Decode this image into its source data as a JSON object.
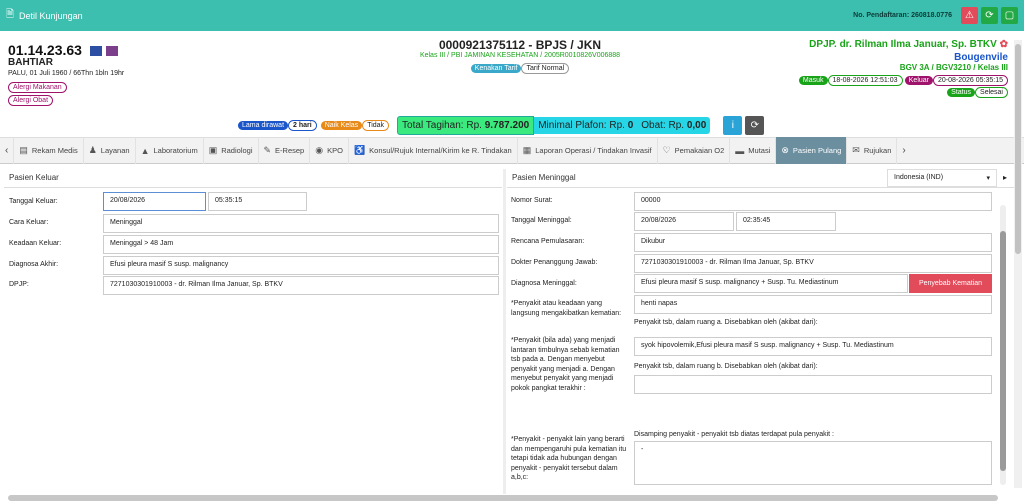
{
  "titlebar": {
    "title": "Detil Kunjungan",
    "reg_label": "No. Pendaftaran:",
    "reg_no": "260818.0776"
  },
  "patient": {
    "id": "01.14.23.63",
    "name": "BAHTIAR",
    "info": "PALU, 01 Juli 1960 / 66Thn 1bln 19hr",
    "allergy_food": "Alergi Makanan",
    "allergy_drug": "Alergi Obat"
  },
  "center": {
    "sep": "0000921375112 - BPJS / JKN",
    "kelas": "Kelas III / PBI JAMINAN KESEHATAN / 2005R0010826V006888",
    "kenakan": "Kenakan Tarif",
    "tarif": "Tarif Normal"
  },
  "right": {
    "dpjp": "DPJP. dr. Rilman Ilma Januar, Sp. BTKV",
    "ward": "Bougenvile",
    "bed": "BGV 3A / BGV3210 / Kelas III",
    "masuk_label": "Masuk",
    "masuk": "18-08-2026 12:51:03",
    "keluar_label": "Keluar",
    "keluar": "20-08-2026 05:35:15",
    "status_label": "Status",
    "status": "Selesai"
  },
  "billing": {
    "lama_label": "Lama dirawat",
    "lama": "2 hari",
    "naik_label": "Naik Kelas",
    "naik": "Tidak",
    "total_label": "Total Tagihan: Rp.",
    "total": "9.787.200",
    "plafon_label": "Minimal Plafon: Rp.",
    "plafon": "0",
    "obat_label": "Obat: Rp.",
    "obat": "0,00"
  },
  "tabs": [
    {
      "label": "Rekam Medis",
      "icon": "document-icon"
    },
    {
      "label": "Layanan",
      "icon": "users-icon"
    },
    {
      "label": "Laboratorium",
      "icon": "flask-icon"
    },
    {
      "label": "Radiologi",
      "icon": "radiology-icon"
    },
    {
      "label": "E-Resep",
      "icon": "pen-icon"
    },
    {
      "label": "KPO",
      "icon": "pills-icon"
    },
    {
      "label": "Konsul/Rujuk Internal/Kirim ke R. Tindakan",
      "icon": "wheelchair-icon"
    },
    {
      "label": "Laporan Operasi / Tindakan Invasif",
      "icon": "report-icon"
    },
    {
      "label": "Pemakaian O2",
      "icon": "heart-icon"
    },
    {
      "label": "Mutasi",
      "icon": "bed-icon"
    },
    {
      "label": "Pasien Pulang",
      "icon": "exit-icon"
    },
    {
      "label": "Rujukan",
      "icon": "mail-icon"
    }
  ],
  "keluar_panel": {
    "title": "Pasien Keluar",
    "tanggal_label": "Tanggal Keluar:",
    "tanggal": "20/08/2026",
    "jam": "05:35:15",
    "cara_label": "Cara Keluar:",
    "cara": "Meninggal",
    "keadaan_label": "Keadaan Keluar:",
    "keadaan": "Meninggal > 48 Jam",
    "diagnosa_label": "Diagnosa Akhir:",
    "diagnosa": "Efusi pleura masif S susp. malignancy",
    "dpjp_label": "DPJP:",
    "dpjp": "7271030301910003 - dr. Rilman Ilma Januar, Sp. BTKV"
  },
  "meninggal_panel": {
    "title": "Pasien Meninggal",
    "lang": "Indonesia (IND)",
    "surat_label": "Nomor Surat:",
    "surat": "00000",
    "tgl_label": "Tanggal Meninggal:",
    "tgl": "20/08/2026",
    "jam": "02:35:45",
    "rencana_label": "Rencana Pemulasaran:",
    "rencana": "Dikubur",
    "dokter_label": "Dokter Penanggung Jawab:",
    "dokter": "7271030301910003 - dr. Rilman Ilma Januar, Sp. BTKV",
    "diag_label": "Diagnosa Meninggal:",
    "diag": "Efusi pleura masif S susp. malignancy + Susp. Tu. Mediastinum",
    "penyebab_btn": "Penyebab Kematian",
    "q1_label": "*Penyakit atau keadaan yang langsung mengakibatkan kematian:",
    "q1_value": "henti napas",
    "q2_caption": "Penyakit tsb, dalam ruang a. Disebabkan oleh (akibat dari):",
    "q2_label": "*Penyakit (bila ada) yang menjadi lantaran timbulnya sebab kematian tsb pada a. Dengan menyebut penyakit yang menjadi a. Dengan menyebut penyakit yang menjadi pokok pangkat terakhir :",
    "q2_value": "syok hipovolemik,Efusi pleura masif S susp. malignancy + Susp. Tu. Mediastinum",
    "q3_caption": "Penyakit tsb, dalam ruang b. Disebabkan oleh (akibat dari):",
    "q3_value": "",
    "q4_caption": "Disamping penyakit - penyakit tsb diatas terdapat pula penyakit :",
    "q4_label": "*Penyakit - penyakit lain yang berarti dan mempengaruhi pula kematian itu tetapi tidak ada hubungan dengan penyakit - penyakit tersebut dalam a,b,c:",
    "q4_value": "-"
  },
  "colors": {
    "teal": "#3cbfae",
    "green_total": "#3bea7e",
    "cyan_plafon": "#26d6e6",
    "dpjp_green": "#19a319",
    "ward_blue": "#1a55c9",
    "red": "#e14b5a"
  }
}
